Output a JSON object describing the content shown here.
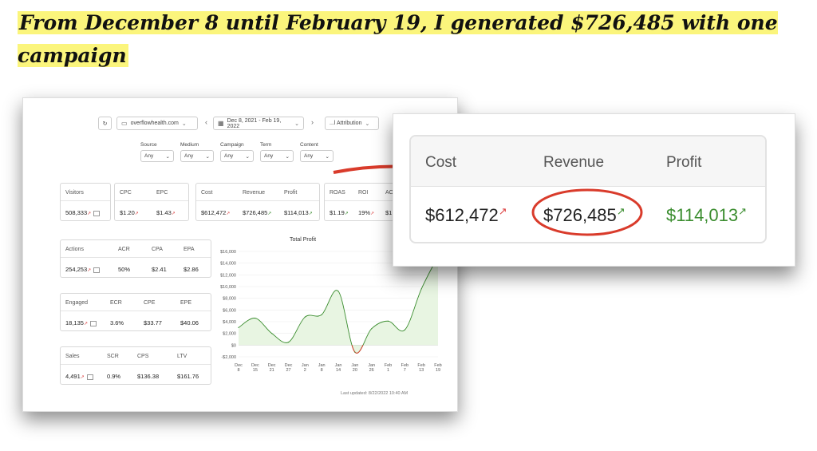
{
  "headline": "From December 8 until February 19, I generated $726,485 with one campaign",
  "toolbar": {
    "refresh_icon": "refresh-icon",
    "domain": "overflowhealth.com",
    "date_range": "Dec 8, 2021 - Feb 19, 2022",
    "attribution": "...l Attribution"
  },
  "filters": [
    {
      "label": "Source",
      "value": "Any"
    },
    {
      "label": "Medium",
      "value": "Any"
    },
    {
      "label": "Campaign",
      "value": "Any"
    },
    {
      "label": "Term",
      "value": "Any"
    },
    {
      "label": "Content",
      "value": "Any"
    }
  ],
  "visitors": {
    "label": "Visitors",
    "value": "508,333"
  },
  "cpc_card": {
    "h1": "CPC",
    "v1": "$1.20",
    "h2": "EPC",
    "v2": "$1.43"
  },
  "money_card": {
    "h1": "Cost",
    "v1": "$612,472",
    "h2": "Revenue",
    "v2": "$726,485",
    "h3": "Profit",
    "v3": "$114,013"
  },
  "roas_card": {
    "h1": "ROAS",
    "v1": "$1.19",
    "h2": "ROI",
    "v2": "19%",
    "h3": "AO",
    "v3": "$1"
  },
  "actions_card": {
    "h1": "Actions",
    "v1": "254,253",
    "h2": "ACR",
    "v2": "50%",
    "h3": "CPA",
    "v3": "$2.41",
    "h4": "EPA",
    "v4": "$2.86"
  },
  "engaged_card": {
    "h1": "Engaged",
    "v1": "18,135",
    "h2": "ECR",
    "v2": "3.6%",
    "h3": "CPE",
    "v3": "$33.77",
    "h4": "EPE",
    "v4": "$40.06"
  },
  "sales_card": {
    "h1": "Sales",
    "v1": "4,491",
    "h2": "SCR",
    "v2": "0.9%",
    "h3": "CPS",
    "v3": "$136.38",
    "h4": "LTV",
    "v4": "$161.76"
  },
  "last_updated": "Last updated: 8/22/2022 10:40 AM",
  "zoom": {
    "h_cost": "Cost",
    "h_rev": "Revenue",
    "h_profit": "Profit",
    "cost": "$612,472",
    "revenue": "$726,485",
    "profit": "$114,013"
  },
  "colors": {
    "highlight": "#fbf57c",
    "profit_green": "#3b8d2f",
    "arrow_red": "#d93b2b",
    "area_fill": "#e8f5e2"
  },
  "chart_data": {
    "type": "area",
    "title": "Total Profit",
    "x": [
      "Dec 8",
      "Dec 15",
      "Dec 21",
      "Dec 27",
      "Jan 2",
      "Jan 8",
      "Jan 14",
      "Jan 20",
      "Jan 26",
      "Feb 1",
      "Feb 7",
      "Feb 13",
      "Feb 19"
    ],
    "y_ticks": [
      "$16,000",
      "$14,000",
      "$12,000",
      "$10,000",
      "$8,000",
      "$6,000",
      "$4,000",
      "$2,000",
      "$0",
      "-$2,000"
    ],
    "ylim": [
      -2000,
      16000
    ],
    "values": [
      3000,
      4600,
      2000,
      500,
      4800,
      5200,
      9200,
      -1200,
      2800,
      4100,
      2600,
      9600,
      15200
    ],
    "grid": true,
    "line_color": "#3b8d2f",
    "negative_color": "#d93b2b"
  }
}
